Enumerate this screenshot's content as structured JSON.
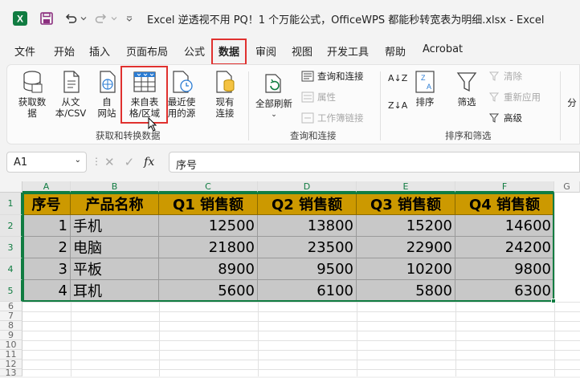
{
  "titlebar": {
    "title": "Excel 逆透视不用 PQ！1 个万能公式，OfficeWPS 都能秒转宽表为明细.xlsx  -  Excel"
  },
  "menu": [
    {
      "label": "文件"
    },
    {
      "label": "开始"
    },
    {
      "label": "插入"
    },
    {
      "label": "页面布局"
    },
    {
      "label": "公式"
    },
    {
      "label": "数据"
    },
    {
      "label": "审阅"
    },
    {
      "label": "视图"
    },
    {
      "label": "开发工具"
    },
    {
      "label": "帮助"
    },
    {
      "label": "Acrobat"
    }
  ],
  "ribbon": {
    "get_data": "获取数\n据",
    "from_text": "从文\n本/CSV",
    "from_web": "自\n网站",
    "from_table": "来自表\n格/区域",
    "recent_sources": "最近使\n用的源",
    "existing_conn": "现有\n连接",
    "group1": "获取和转换数据",
    "refresh_all": "全部刷新",
    "queries_conn": "查询和连接",
    "properties": "属性",
    "workbook_links": "工作簿链接",
    "group2": "查询和连接",
    "sort_asc": "A↓Z",
    "sort_desc": "Z↓A",
    "sort": "排序",
    "filter": "筛选",
    "clear": "清除",
    "reapply": "重新应用",
    "advanced": "高级",
    "group3": "排序和筛选",
    "split": "分"
  },
  "formula": {
    "namebox": "A1",
    "fx": "fx",
    "value": "序号"
  },
  "grid": {
    "columns": [
      "A",
      "B",
      "C",
      "D",
      "E",
      "F",
      "G"
    ],
    "rows": [
      "1",
      "2",
      "3",
      "4",
      "5",
      "6",
      "7",
      "8",
      "9",
      "10",
      "11",
      "12",
      "13"
    ],
    "header": [
      "序号",
      "产品名称",
      "Q1 销售额",
      "Q2 销售额",
      "Q3 销售额",
      "Q4 销售额"
    ],
    "data": [
      [
        "1",
        "手机",
        "12500",
        "13800",
        "15200",
        "14600"
      ],
      [
        "2",
        "电脑",
        "21800",
        "23500",
        "22900",
        "24200"
      ],
      [
        "3",
        "平板",
        "8900",
        "9500",
        "10200",
        "9800"
      ],
      [
        "4",
        "耳机",
        "5600",
        "6100",
        "5800",
        "6300"
      ]
    ]
  },
  "colors": {
    "header_fill": "#cc9900",
    "data_fill": "#c8c8c8",
    "highlight": "#e0312f",
    "excel_green": "#107c41"
  }
}
